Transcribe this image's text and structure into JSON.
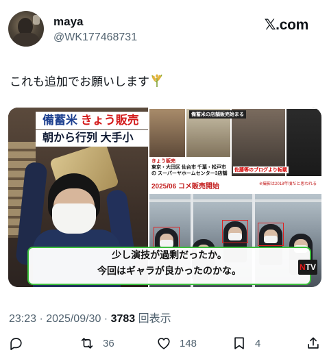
{
  "author": {
    "display_name": "maya",
    "handle": "@WK177468731"
  },
  "brand": "𝕏.com",
  "post": {
    "text": "これも追加でお願いします",
    "emoji_icon": "rice-plant-icon"
  },
  "media": {
    "banner_line1_blue": "備蓄米",
    "banner_line1_red": "きょう販売",
    "banner_line2": "朝から行列 大手小",
    "small_title": "備蓄米の店舗販売始まる",
    "thumb_caption_red": "きょう販売",
    "thumb_caption": "東京・大田区 仙台市 千葉・松戸市の スーパーヤホームセンター3店舗",
    "thumb_label": "佐藤等のブログより転載",
    "thumb_note": "※撮影は2018年頃だと思われる",
    "date_strip": "2025/06 コメ販売開始",
    "subtitle_line1": "少し演技が過剰だったか。",
    "subtitle_line2": "今回はギャラが良かったのかな。",
    "logo_n": "N",
    "logo_tv": "TV"
  },
  "meta": {
    "time_date": "23:23 · 2025/09/30 · ",
    "views_count": "3783",
    "views_label": " 回表示"
  },
  "actions": {
    "retweets": "36",
    "likes": "148",
    "bookmarks": "4"
  },
  "colors": {
    "text_primary": "#0f1419",
    "text_secondary": "#536471",
    "subtitle_border": "#3cbf3c"
  }
}
